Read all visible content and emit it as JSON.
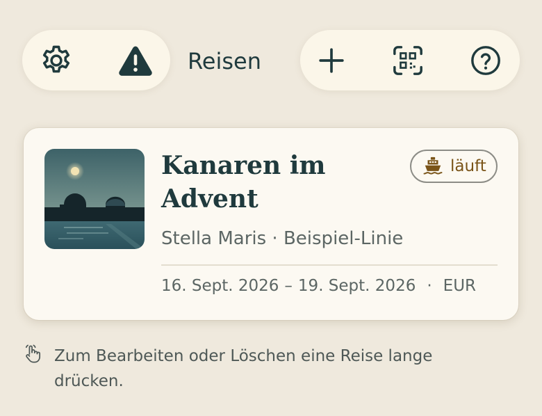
{
  "toolbar": {
    "title": "Reisen",
    "settings_icon": "gear-icon",
    "warning_icon": "warning-triangle-icon",
    "add_icon": "plus-icon",
    "scan_icon": "qr-scan-icon",
    "help_icon": "question-circle-icon"
  },
  "trip": {
    "title": "Kanaren im Advent",
    "status": "läuft",
    "status_icon": "ship-icon",
    "ship": "Stella Maris · Beispiel-Linie",
    "start_date": "16. Sept. 2026",
    "date_separator": "–",
    "end_date": "19. Sept. 2026",
    "meta_separator": "·",
    "currency": "EUR"
  },
  "hint": {
    "icon": "hand-pointer-icon",
    "text": "Zum Bearbeiten oder Löschen eine Reise lange drücken."
  },
  "colors": {
    "background": "#efe9dd",
    "surface": "#fbf6e9",
    "primary_text": "#1f3a3d",
    "status_accent": "#7a5418"
  }
}
